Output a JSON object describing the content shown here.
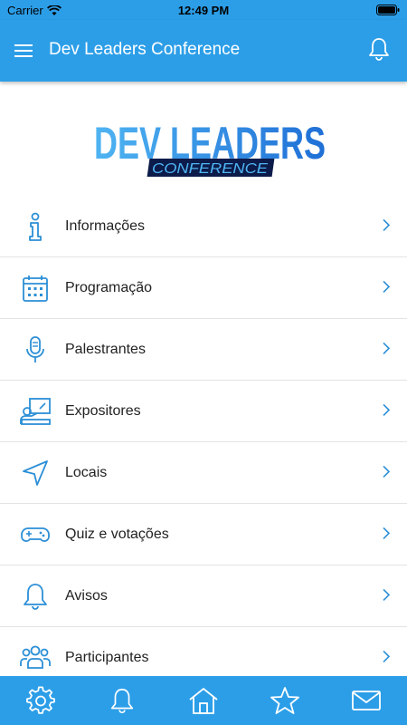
{
  "status_bar": {
    "carrier": "Carrier",
    "time": "12:49 PM"
  },
  "app_bar": {
    "title": "Dev Leaders Conference"
  },
  "logo": {
    "main": "DEV LEADERS",
    "sub": "CONFERENCE"
  },
  "menu": [
    {
      "label": "Informações",
      "icon": "info-icon"
    },
    {
      "label": "Programação",
      "icon": "calendar-icon"
    },
    {
      "label": "Palestrantes",
      "icon": "microphone-icon"
    },
    {
      "label": "Expositores",
      "icon": "presenter-icon"
    },
    {
      "label": "Locais",
      "icon": "location-arrow-icon"
    },
    {
      "label": "Quiz e votações",
      "icon": "gamepad-icon"
    },
    {
      "label": "Avisos",
      "icon": "bell-icon"
    },
    {
      "label": "Participantes",
      "icon": "people-icon"
    }
  ],
  "bottom_nav": [
    "gear-icon",
    "bell-icon",
    "home-icon",
    "star-icon",
    "mail-icon"
  ],
  "colors": {
    "primary": "#2c9ee8",
    "icon": "#2c8fd6",
    "logo_dark": "#0c1b4a"
  }
}
